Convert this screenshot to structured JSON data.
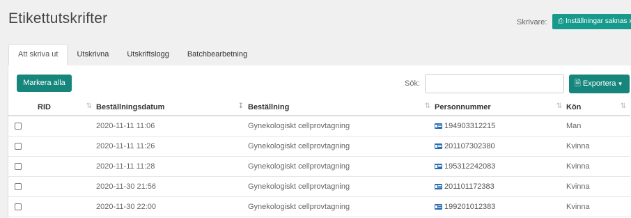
{
  "header": {
    "title": "Etikettutskrifter",
    "printer_label": "Skrivare:",
    "printer_button": "Inställningar saknas x"
  },
  "tabs": [
    {
      "label": "Att skriva ut",
      "active": true
    },
    {
      "label": "Utskrivna",
      "active": false
    },
    {
      "label": "Utskriftslogg",
      "active": false
    },
    {
      "label": "Batchbearbetning",
      "active": false
    }
  ],
  "toolbar": {
    "mark_all": "Markera alla",
    "search_label": "Sök:",
    "search_value": "",
    "export": "Exportera"
  },
  "table": {
    "columns": [
      "RID",
      "Beställningsdatum",
      "Beställning",
      "Personnummer",
      "Kön"
    ],
    "sorted_column": "Beställningsdatum",
    "rows": [
      {
        "rid": "",
        "date": "2020-11-11 11:06",
        "order": "Gynekologiskt cellprovtagning",
        "pnr": "194903312215",
        "gender": "Man"
      },
      {
        "rid": "",
        "date": "2020-11-11 11:26",
        "order": "Gynekologiskt cellprovtagning",
        "pnr": "201107302380",
        "gender": "Kvinna"
      },
      {
        "rid": "",
        "date": "2020-11-11 11:28",
        "order": "Gynekologiskt cellprovtagning",
        "pnr": "195312242083",
        "gender": "Kvinna"
      },
      {
        "rid": "",
        "date": "2020-11-30 21:56",
        "order": "Gynekologiskt cellprovtagning",
        "pnr": "201101172383",
        "gender": "Kvinna"
      },
      {
        "rid": "",
        "date": "2020-11-30 22:00",
        "order": "Gynekologiskt cellprovtagning",
        "pnr": "199201012383",
        "gender": "Kvinna"
      }
    ]
  },
  "colors": {
    "accent": "#16867c",
    "printer_button": "#169a8c",
    "id_icon": "#2a6fb5"
  }
}
